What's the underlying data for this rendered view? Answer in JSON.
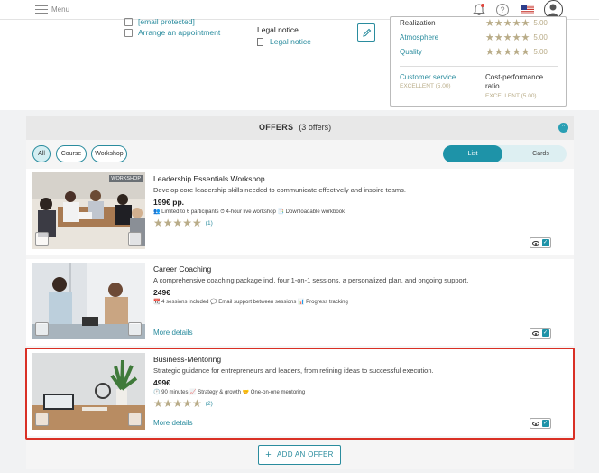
{
  "topbar": {
    "menu_label": "Menu",
    "icons": [
      "hamburger-icon",
      "bell-icon",
      "help-icon",
      "us-flag-icon",
      "user-avatar-icon"
    ],
    "help_glyph": "?"
  },
  "contact": {
    "email": "[email protected]",
    "appointment": "Arrange an appointment"
  },
  "legal": {
    "title": "Legal notice",
    "link": "Legal notice"
  },
  "ratings": {
    "rows": [
      {
        "label": "Realization",
        "stars": "★★★★★",
        "value": "5.00"
      },
      {
        "label": "Atmosphere",
        "stars": "★★★★★",
        "value": "5.00"
      },
      {
        "label": "Quality",
        "stars": "★★★★★",
        "value": "5.00"
      }
    ],
    "customer_service": {
      "label": "Customer service",
      "value": "EXCELLENT (5.00)"
    },
    "cost_performance": {
      "label": "Cost-performance ratio",
      "value": "EXCELLENT (5.00)"
    }
  },
  "offers": {
    "title": "OFFERS",
    "count": "(3 offers)",
    "filters": [
      "All",
      "Course",
      "Workshop"
    ],
    "views": {
      "list": "List",
      "cards": "Cards"
    },
    "items": [
      {
        "title": "Leadership Essentials Workshop",
        "desc": "Develop core leadership skills needed to communicate effectively and inspire teams.",
        "price": "199€ pp.",
        "meta": "👥 Limited to 6 participants  ⏱ 4-hour live workshop  📑 Downloadable workbook",
        "stars": "★★★★★",
        "reviews": "(1)",
        "tag": "WORKSHOP",
        "more": ""
      },
      {
        "title": "Career Coaching",
        "desc": "A comprehensive coaching package incl. four 1-on-1 sessions, a personalized plan, and ongoing support.",
        "price": "249€",
        "meta": "📆 4 sessions included  💬 Email support between sessions  📊 Progress tracking",
        "stars": "",
        "reviews": "",
        "tag": "",
        "more": "More details"
      },
      {
        "title": "Business-Mentoring",
        "desc": "Strategic guidance for entrepreneurs and leaders, from refining ideas to successful execution.",
        "price": "499€",
        "meta": "🕐 90 minutes  📈 Strategy & growth  🤝 One-on-one mentoring",
        "stars": "★★★★★",
        "reviews": "(2)",
        "tag": "",
        "more": "More details"
      }
    ],
    "add_label": "ADD AN OFFER",
    "add_glyph": "+",
    "collapse_glyph": "⌃",
    "check_glyph": "✓"
  },
  "colors": {
    "accent": "#1e93a8",
    "star": "#b9ac88",
    "highlight": "#d93025"
  }
}
